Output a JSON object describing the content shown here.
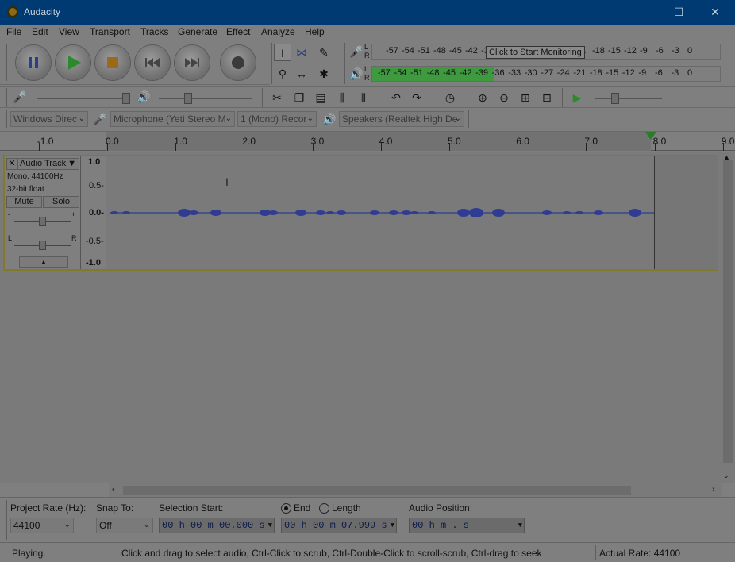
{
  "window": {
    "title": "Audacity",
    "controls": {
      "minimize": "—",
      "maximize": "☐",
      "close": "✕"
    }
  },
  "menubar": [
    "File",
    "Edit",
    "View",
    "Transport",
    "Tracks",
    "Generate",
    "Effect",
    "Analyze",
    "Help"
  ],
  "meters": {
    "record_scale": [
      "-57",
      "-54",
      "-51",
      "-48",
      "-45",
      "-42",
      "-3",
      "21",
      "-18",
      "-15",
      "-12",
      "-9",
      "-6",
      "-3",
      "0"
    ],
    "playback_scale": [
      "-57",
      "-54",
      "-51",
      "-48",
      "-45",
      "-42",
      "-39",
      "-36",
      "-33",
      "-30",
      "-27",
      "-24",
      "-21",
      "-18",
      "-15",
      "-12",
      "-9",
      "-6",
      "-3",
      "0"
    ],
    "tooltip": "Click to Start Monitoring",
    "lr": [
      "L",
      "R"
    ],
    "playback_level_fraction": 0.35
  },
  "devices": {
    "host": "Windows Direc",
    "microphone": "Microphone (Yeti Stereo M",
    "channels": "1 (Mono) Recor",
    "speakers": "Speakers (Realtek High De"
  },
  "ruler": {
    "ticks": [
      {
        "label": "-1.0",
        "value": -1.0
      },
      {
        "label": "0.0",
        "value": 0.0
      },
      {
        "label": "1.0",
        "value": 1.0
      },
      {
        "label": "2.0",
        "value": 2.0
      },
      {
        "label": "3.0",
        "value": 3.0
      },
      {
        "label": "4.0",
        "value": 4.0
      },
      {
        "label": "5.0",
        "value": 5.0
      },
      {
        "label": "6.0",
        "value": 6.0
      },
      {
        "label": "7.0",
        "value": 7.0
      },
      {
        "label": "8.0",
        "value": 8.0
      },
      {
        "label": "9.0",
        "value": 9.0
      }
    ]
  },
  "track": {
    "name": "Audio Track",
    "info_line1": "Mono, 44100Hz",
    "info_line2": "32-bit float",
    "mute": "Mute",
    "solo": "Solo",
    "gain_minus": "-",
    "gain_plus": "+",
    "pan_left": "L",
    "pan_right": "R",
    "scale": [
      "1.0",
      "0.5-",
      "0.0-",
      "-0.5-",
      "-1.0"
    ]
  },
  "selection_toolbar": {
    "project_rate_label": "Project Rate (Hz):",
    "project_rate_value": "44100",
    "snap_to_label": "Snap To:",
    "snap_to_value": "Off",
    "selection_start_label": "Selection Start:",
    "selection_start_value": "00 h 00 m 00.000 s",
    "end_label": "End",
    "length_label": "Length",
    "end_value": "00 h 00 m 07.999 s",
    "audio_position_label": "Audio Position:",
    "audio_position_value": "00 h    m    .     s"
  },
  "status": {
    "state": "Playing.",
    "hint": "Click and drag to select audio, Ctrl-Click to scrub, Ctrl-Double-Click to scroll-scrub, Ctrl-drag to seek",
    "rate": "Actual Rate: 44100"
  },
  "colors": {
    "titlebar": "#003a73",
    "waveform": "#2f3c92",
    "meter_green": "#3f9a3f",
    "play_green": "#2c8a2c"
  }
}
